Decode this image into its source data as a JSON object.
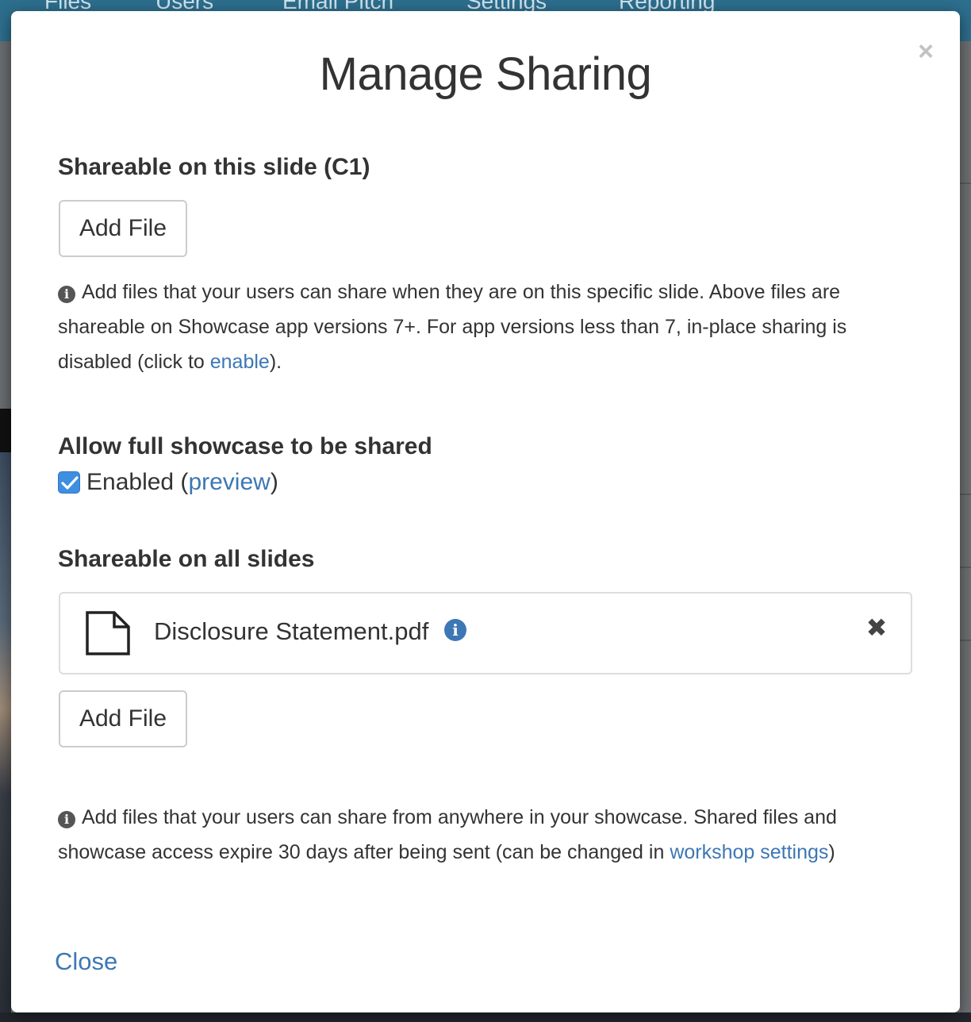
{
  "background_nav": {
    "items": [
      "Files",
      "Users",
      "Email Pitch",
      "Settings",
      "Reporting"
    ]
  },
  "modal": {
    "title": "Manage Sharing",
    "close_glyph": "×",
    "slide_section": {
      "heading": "Shareable on this slide (C1)",
      "add_button_label": "Add File",
      "help_text_before_link": "Add files that your users can share when they are on this specific slide. Above files are shareable on Showcase app versions 7+. For app versions less than 7, in-place sharing is disabled (click to ",
      "help_link": "enable",
      "help_text_after_link": ")."
    },
    "full_showcase_section": {
      "heading": "Allow full showcase to be shared",
      "checkbox_checked": true,
      "checkbox_label": "Enabled (",
      "preview_link": "preview",
      "checkbox_label_after": ")"
    },
    "all_slides_section": {
      "heading": "Shareable on all slides",
      "files": [
        {
          "name": "Disclosure Statement.pdf",
          "icon": "document-icon"
        }
      ],
      "remove_glyph": "✖",
      "info_glyph": "i",
      "add_button_label": "Add File",
      "help_text_before_link": "Add files that your users can share from anywhere in your showcase. Shared files and showcase access expire 30 days after being sent (can be changed in ",
      "help_link": "workshop settings",
      "help_text_after_link": ")"
    },
    "footer": {
      "close_label": "Close"
    }
  },
  "colors": {
    "link": "#3d77b5",
    "checkbox": "#3f8fe0",
    "nav_background": "#2d6f8e"
  }
}
